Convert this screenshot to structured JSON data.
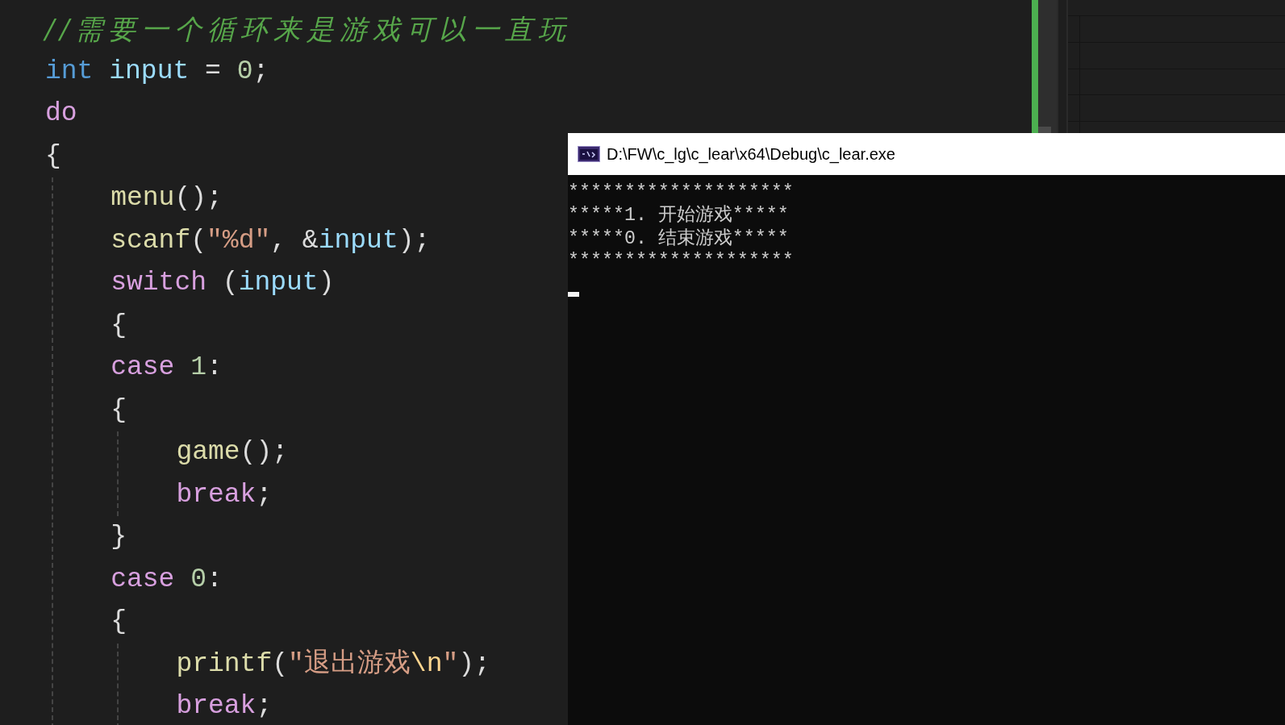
{
  "editor": {
    "lines": [
      {
        "tokens": [
          {
            "text": "//需要一个循环来是游戏可以一直玩",
            "kind": "comment"
          }
        ]
      },
      {
        "tokens": [
          {
            "text": "int",
            "kind": "keyword"
          },
          {
            "text": " input",
            "kind": "variable"
          },
          {
            "text": " = ",
            "kind": "punct"
          },
          {
            "text": "0",
            "kind": "number"
          },
          {
            "text": ";",
            "kind": "punct"
          }
        ]
      },
      {
        "tokens": [
          {
            "text": "do",
            "kind": "control"
          }
        ]
      },
      {
        "tokens": [
          {
            "text": "{",
            "kind": "punct"
          }
        ],
        "children": [
          {
            "tokens": [
              {
                "text": "menu",
                "kind": "function"
              },
              {
                "text": "();",
                "kind": "punct"
              }
            ]
          },
          {
            "tokens": [
              {
                "text": "scanf",
                "kind": "function"
              },
              {
                "text": "(",
                "kind": "punct"
              },
              {
                "text": "\"%d\"",
                "kind": "string"
              },
              {
                "text": ", &",
                "kind": "punct"
              },
              {
                "text": "input",
                "kind": "variable"
              },
              {
                "text": ");",
                "kind": "punct"
              }
            ]
          },
          {
            "tokens": [
              {
                "text": "switch",
                "kind": "control"
              },
              {
                "text": " (",
                "kind": "punct"
              },
              {
                "text": "input",
                "kind": "variable"
              },
              {
                "text": ")",
                "kind": "punct"
              }
            ]
          },
          {
            "tokens": [
              {
                "text": "{",
                "kind": "punct"
              }
            ]
          },
          {
            "tokens": [
              {
                "text": "case ",
                "kind": "control"
              },
              {
                "text": "1",
                "kind": "number"
              },
              {
                "text": ":",
                "kind": "punct"
              }
            ]
          },
          {
            "tokens": [
              {
                "text": "{",
                "kind": "punct"
              }
            ],
            "children": [
              {
                "tokens": [
                  {
                    "text": "game",
                    "kind": "function"
                  },
                  {
                    "text": "();",
                    "kind": "punct"
                  }
                ]
              },
              {
                "tokens": [
                  {
                    "text": "break",
                    "kind": "control"
                  },
                  {
                    "text": ";",
                    "kind": "punct"
                  }
                ]
              }
            ]
          },
          {
            "tokens": [
              {
                "text": "}",
                "kind": "punct"
              }
            ]
          },
          {
            "tokens": [
              {
                "text": "case ",
                "kind": "control"
              },
              {
                "text": "0",
                "kind": "number"
              },
              {
                "text": ":",
                "kind": "punct"
              }
            ]
          },
          {
            "tokens": [
              {
                "text": "{",
                "kind": "punct"
              }
            ],
            "children": [
              {
                "tokens": [
                  {
                    "text": "printf",
                    "kind": "function"
                  },
                  {
                    "text": "(",
                    "kind": "punct"
                  },
                  {
                    "text": "\"退出游戏",
                    "kind": "string"
                  },
                  {
                    "text": "\\n",
                    "kind": "escape"
                  },
                  {
                    "text": "\"",
                    "kind": "string"
                  },
                  {
                    "text": ");",
                    "kind": "punct"
                  }
                ]
              },
              {
                "tokens": [
                  {
                    "text": "break",
                    "kind": "control"
                  },
                  {
                    "text": ";",
                    "kind": "punct"
                  }
                ]
              }
            ]
          }
        ]
      }
    ]
  },
  "console": {
    "title": "D:\\FW\\c_lg\\c_lear\\x64\\Debug\\c_lear.exe",
    "lines": [
      "********************",
      "*****1. 开始游戏*****",
      "*****0. 结束游戏*****",
      "********************"
    ]
  }
}
